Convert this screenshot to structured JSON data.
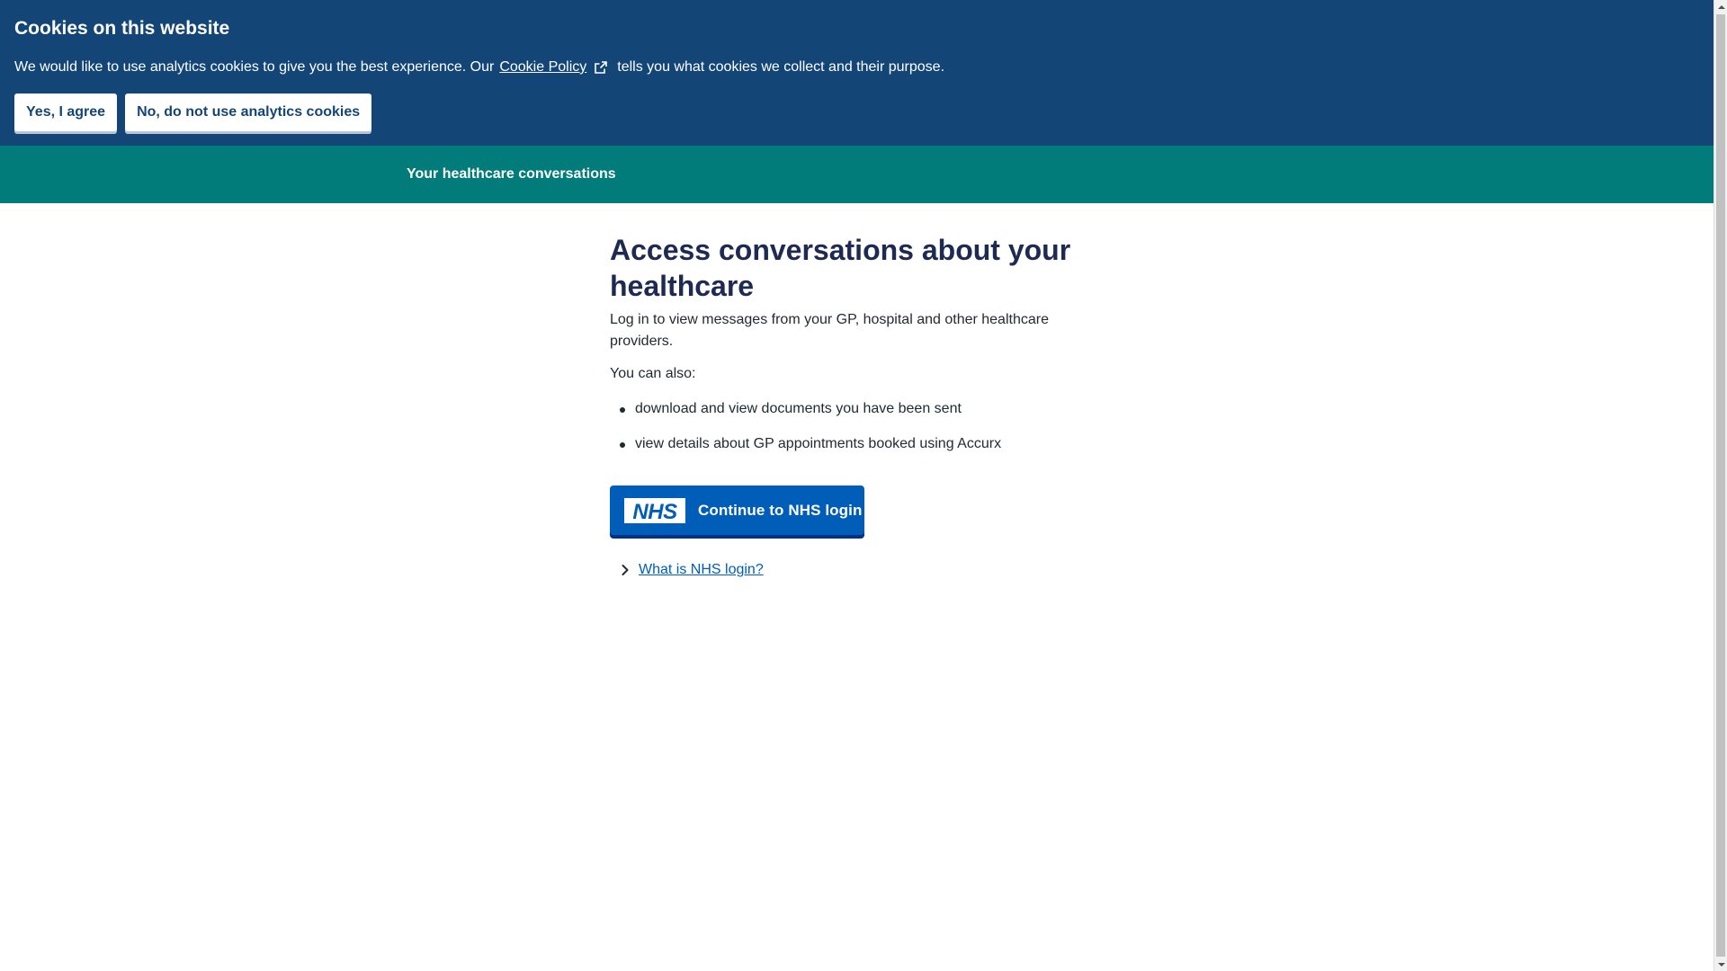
{
  "cookie_banner": {
    "title": "Cookies on this website",
    "text_before": "We would like to use analytics cookies to give you the best experience. Our",
    "policy_link": "Cookie Policy",
    "text_after": "tells you what cookies we collect and their purpose.",
    "accept_label": "Yes, I agree",
    "reject_label": "No, do not use analytics cookies",
    "background_color": "#134677"
  },
  "header": {
    "service_name": "Your healthcare conversations",
    "background_color": "#027b7b"
  },
  "main": {
    "heading": "Access conversations about your healthcare",
    "lead": "Log in to view messages from your GP, hospital and other healthcare providers.",
    "also_label": "You can also:",
    "bullets": [
      "download and view documents you have been sent",
      "view details about GP appointments booked using Accurx"
    ],
    "login_button": {
      "logo_text": "NHS",
      "label": "Continue to NHS login",
      "color": "#005eb8"
    },
    "details_link": "What is NHS login?"
  },
  "icons": {
    "external_link": "external-link-icon",
    "chevron": "chevron-right-icon",
    "nhs_logo": "nhs-logo"
  }
}
